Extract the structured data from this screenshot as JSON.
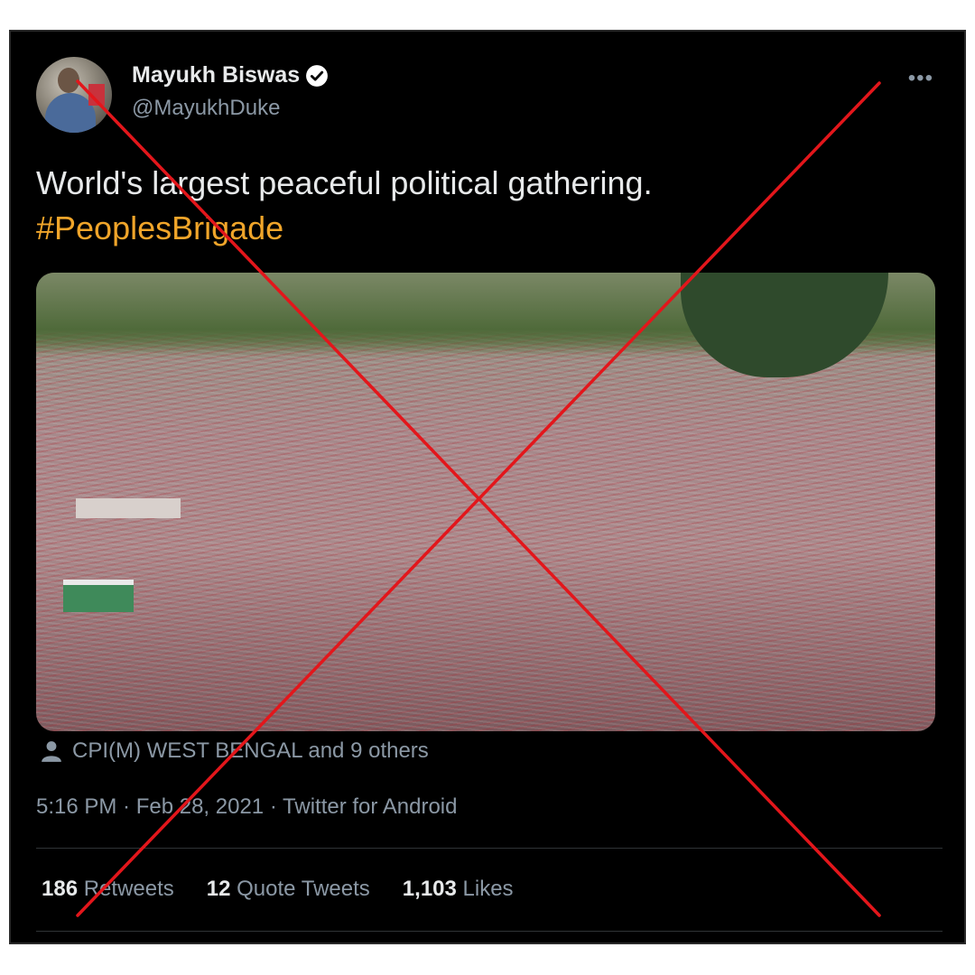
{
  "tweet": {
    "display_name": "Mayukh Biswas",
    "handle": "@MayukhDuke",
    "more_icon": "more-horizontal-icon",
    "text": "World's largest peaceful political gathering.",
    "hashtag": "#PeoplesBrigade",
    "tagged": "CPI(M) WEST BENGAL and 9 others",
    "meta": "5:16 PM · Feb 28, 2021 · Twitter for Android",
    "stats": {
      "retweets_count": "186",
      "retweets_label": "Retweets",
      "quotes_count": "12",
      "quotes_label": "Quote Tweets",
      "likes_count": "1,103",
      "likes_label": "Likes"
    }
  },
  "colors": {
    "background": "#000000",
    "hashtag": "#f0a52a",
    "cross": "#e3161b",
    "verified": "#ffffff"
  }
}
